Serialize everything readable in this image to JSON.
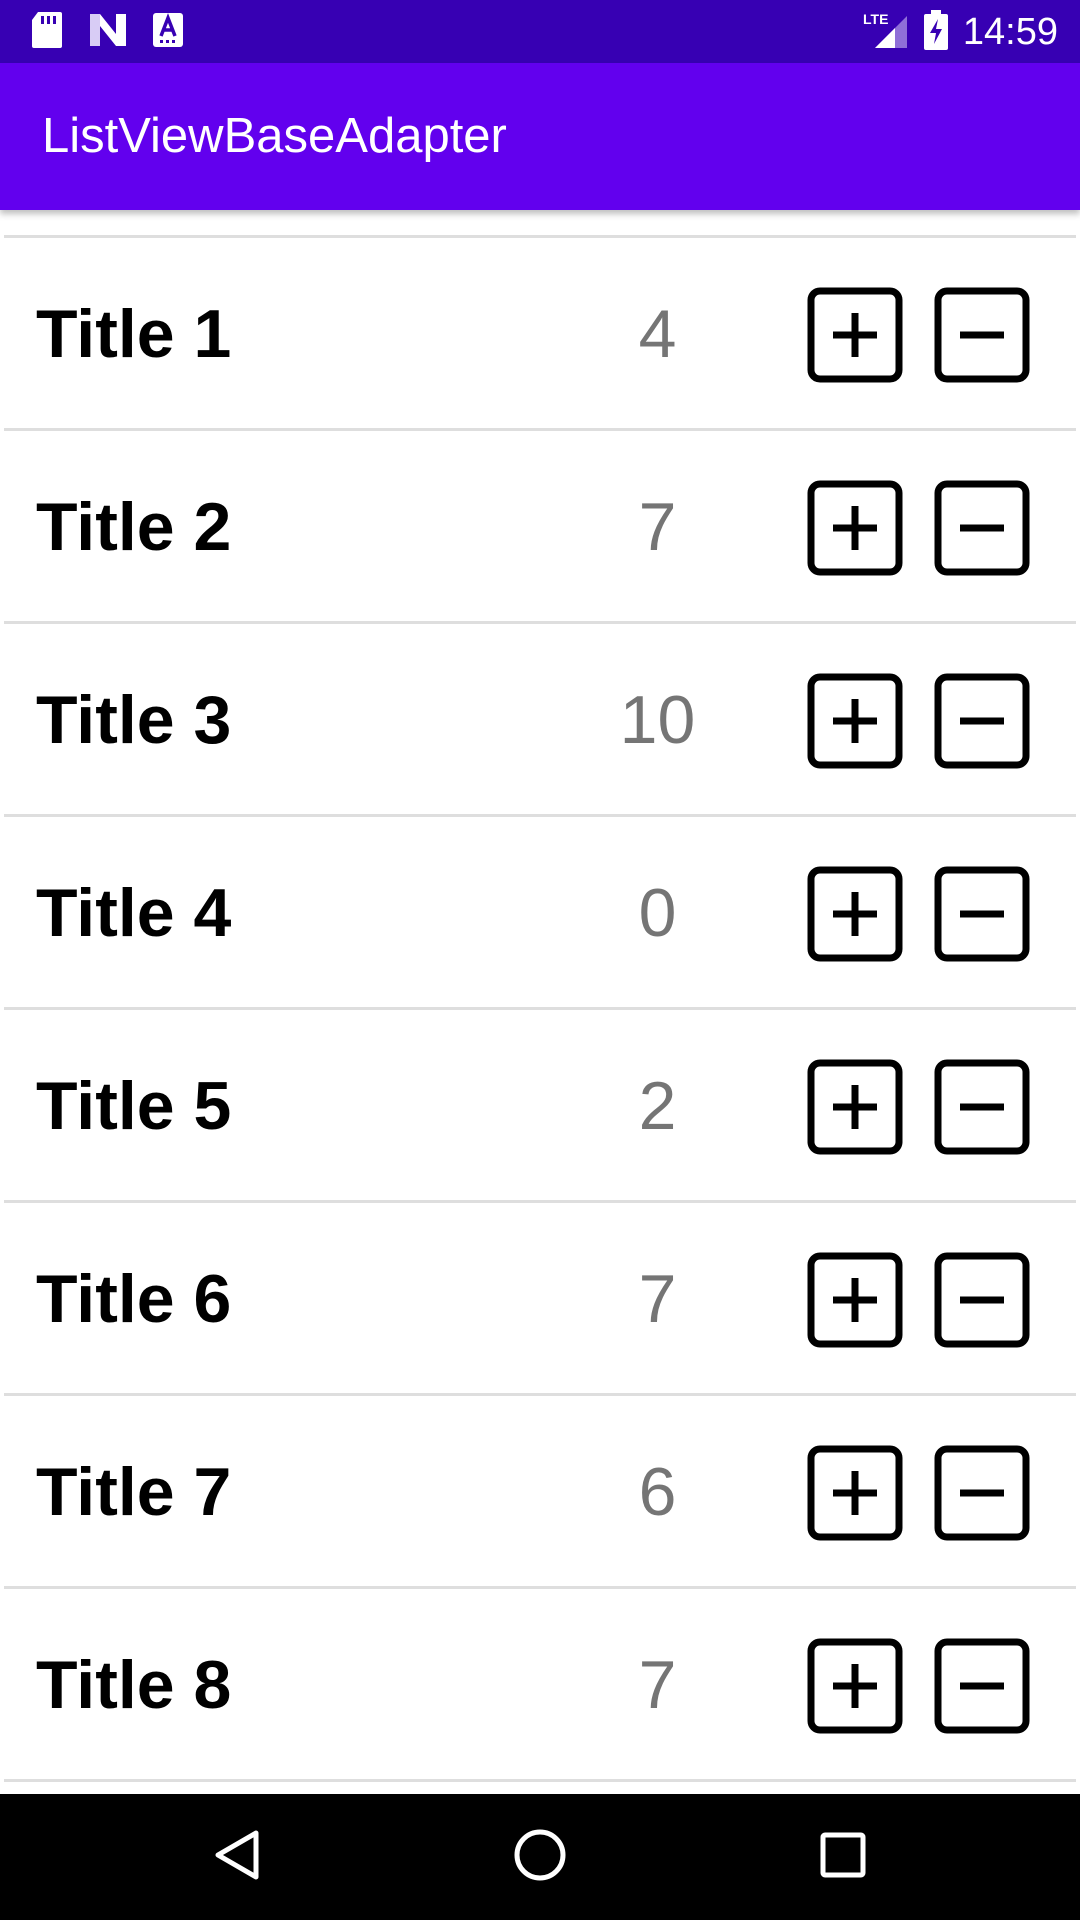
{
  "status_bar": {
    "time": "14:59",
    "network": "LTE",
    "left_icons": [
      "sd-card-icon",
      "n-logo-icon",
      "keyboard-a-icon"
    ],
    "right_icons": [
      "lte-signal-icon",
      "battery-charging-icon"
    ]
  },
  "app_bar": {
    "title": "ListViewBaseAdapter",
    "color": "#6200ee",
    "status_color": "#3700b3"
  },
  "list": {
    "items": [
      {
        "title": "Title 1",
        "count": "4"
      },
      {
        "title": "Title 2",
        "count": "7"
      },
      {
        "title": "Title 3",
        "count": "10"
      },
      {
        "title": "Title 4",
        "count": "0"
      },
      {
        "title": "Title 5",
        "count": "2"
      },
      {
        "title": "Title 6",
        "count": "7"
      },
      {
        "title": "Title 7",
        "count": "6"
      },
      {
        "title": "Title 8",
        "count": "7"
      }
    ],
    "plus_icon": "plus-box-icon",
    "minus_icon": "minus-box-icon"
  },
  "nav_bar": {
    "buttons": [
      "back-icon",
      "home-icon",
      "recents-icon"
    ]
  }
}
